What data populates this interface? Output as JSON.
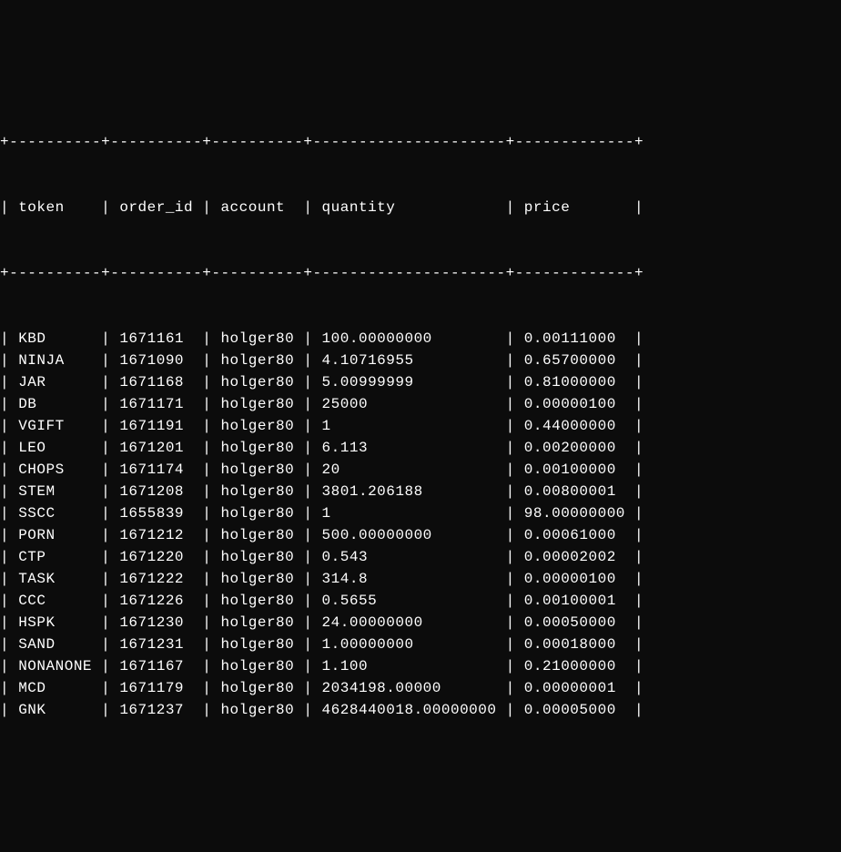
{
  "columns": {
    "token": "token",
    "order_id": "order_id",
    "account": "account",
    "quantity": "quantity",
    "price": "price"
  },
  "rows": [
    {
      "token": "KBD",
      "order_id": "1671161",
      "account": "holger80",
      "quantity": "100.00000000",
      "price": "0.00111000"
    },
    {
      "token": "NINJA",
      "order_id": "1671090",
      "account": "holger80",
      "quantity": "4.10716955",
      "price": "0.65700000"
    },
    {
      "token": "JAR",
      "order_id": "1671168",
      "account": "holger80",
      "quantity": "5.00999999",
      "price": "0.81000000"
    },
    {
      "token": "DB",
      "order_id": "1671171",
      "account": "holger80",
      "quantity": "25000",
      "price": "0.00000100"
    },
    {
      "token": "VGIFT",
      "order_id": "1671191",
      "account": "holger80",
      "quantity": "1",
      "price": "0.44000000"
    },
    {
      "token": "LEO",
      "order_id": "1671201",
      "account": "holger80",
      "quantity": "6.113",
      "price": "0.00200000"
    },
    {
      "token": "CHOPS",
      "order_id": "1671174",
      "account": "holger80",
      "quantity": "20",
      "price": "0.00100000"
    },
    {
      "token": "STEM",
      "order_id": "1671208",
      "account": "holger80",
      "quantity": "3801.206188",
      "price": "0.00800001"
    },
    {
      "token": "SSCC",
      "order_id": "1655839",
      "account": "holger80",
      "quantity": "1",
      "price": "98.00000000"
    },
    {
      "token": "PORN",
      "order_id": "1671212",
      "account": "holger80",
      "quantity": "500.00000000",
      "price": "0.00061000"
    },
    {
      "token": "CTP",
      "order_id": "1671220",
      "account": "holger80",
      "quantity": "0.543",
      "price": "0.00002002"
    },
    {
      "token": "TASK",
      "order_id": "1671222",
      "account": "holger80",
      "quantity": "314.8",
      "price": "0.00000100"
    },
    {
      "token": "CCC",
      "order_id": "1671226",
      "account": "holger80",
      "quantity": "0.5655",
      "price": "0.00100001"
    },
    {
      "token": "HSPK",
      "order_id": "1671230",
      "account": "holger80",
      "quantity": "24.00000000",
      "price": "0.00050000"
    },
    {
      "token": "SAND",
      "order_id": "1671231",
      "account": "holger80",
      "quantity": "1.00000000",
      "price": "0.00018000"
    },
    {
      "token": "NONANONE",
      "order_id": "1671167",
      "account": "holger80",
      "quantity": "1.100",
      "price": "0.21000000"
    },
    {
      "token": "MCD",
      "order_id": "1671179",
      "account": "holger80",
      "quantity": "2034198.00000",
      "price": "0.00000001"
    },
    {
      "token": "GNK",
      "order_id": "1671237",
      "account": "holger80",
      "quantity": "4628440018.00000000",
      "price": "0.00005000"
    }
  ],
  "widths": {
    "token": 10,
    "order_id": 10,
    "account": 10,
    "quantity": 21,
    "price": 13
  }
}
